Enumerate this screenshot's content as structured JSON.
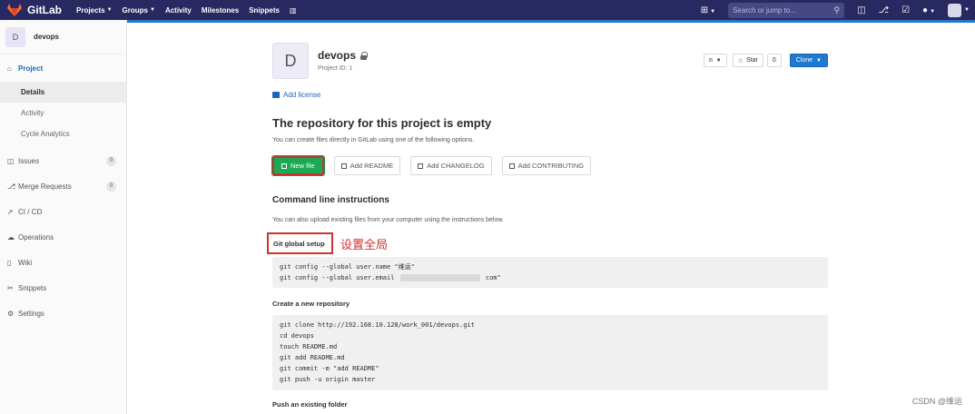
{
  "topnav": {
    "brand": "GitLab",
    "links": [
      {
        "label": "Projects",
        "caret": true
      },
      {
        "label": "Groups",
        "caret": true
      },
      {
        "label": "Activity",
        "caret": false
      },
      {
        "label": "Milestones",
        "caret": false
      },
      {
        "label": "Snippets",
        "caret": false
      }
    ],
    "search_placeholder": "Search or jump to...",
    "icons": [
      "plus-square-icon",
      "search-icon",
      "issues-icon",
      "merge-request-icon",
      "todo-icon",
      "help-icon",
      "user-avatar-icon"
    ]
  },
  "sidebar": {
    "project_initial": "D",
    "project_name": "devops",
    "project_label": "Project",
    "sub_items": [
      "Details",
      "Activity",
      "Cycle Analytics"
    ],
    "items": [
      {
        "label": "Issues",
        "count": "0",
        "icon": "issues-icon"
      },
      {
        "label": "Merge Requests",
        "count": "0",
        "icon": "merge-request-icon"
      },
      {
        "label": "CI / CD",
        "icon": "rocket-icon"
      },
      {
        "label": "Operations",
        "icon": "cloud-icon"
      },
      {
        "label": "Wiki",
        "icon": "book-icon"
      },
      {
        "label": "Snippets",
        "icon": "scissors-icon"
      },
      {
        "label": "Settings",
        "icon": "gear-icon"
      }
    ]
  },
  "project": {
    "initial": "D",
    "name": "devops",
    "id_text": "Project ID: 1",
    "star_label": "Star",
    "star_count": "0",
    "clone_label": "Clone",
    "add_license": "Add license"
  },
  "empty": {
    "title": "The repository for this project is empty",
    "description": "You can create files directly in GitLab using one of the following options.",
    "buttons": {
      "new_file": "New file",
      "add_readme": "Add README",
      "add_changelog": "Add CHANGELOG",
      "add_contributing": "Add CONTRIBUTING"
    }
  },
  "cli": {
    "title": "Command line instructions",
    "description": "You can also upload existing files from your computer using the instructions below.",
    "global_setup": "Git global setup",
    "annotation": "设置全局",
    "global_lines": [
      "git config --global user.name \"维运\"",
      "git config --global user.email "
    ],
    "email_suffix": " com\"",
    "new_repo_title": "Create a new repository",
    "new_repo_lines": [
      "git clone http://192.168.10.128/work_001/devops.git",
      "cd devops",
      "touch README.md",
      "git add README.md",
      "git commit -m \"add README\"",
      "git push -u origin master"
    ],
    "push_folder_title": "Push an existing folder"
  },
  "watermark": "CSDN @维运",
  "colors": {
    "nav_bg": "#292961",
    "accent": "#1f78d1",
    "success": "#1aaa55",
    "annotation": "#d32f2f"
  }
}
